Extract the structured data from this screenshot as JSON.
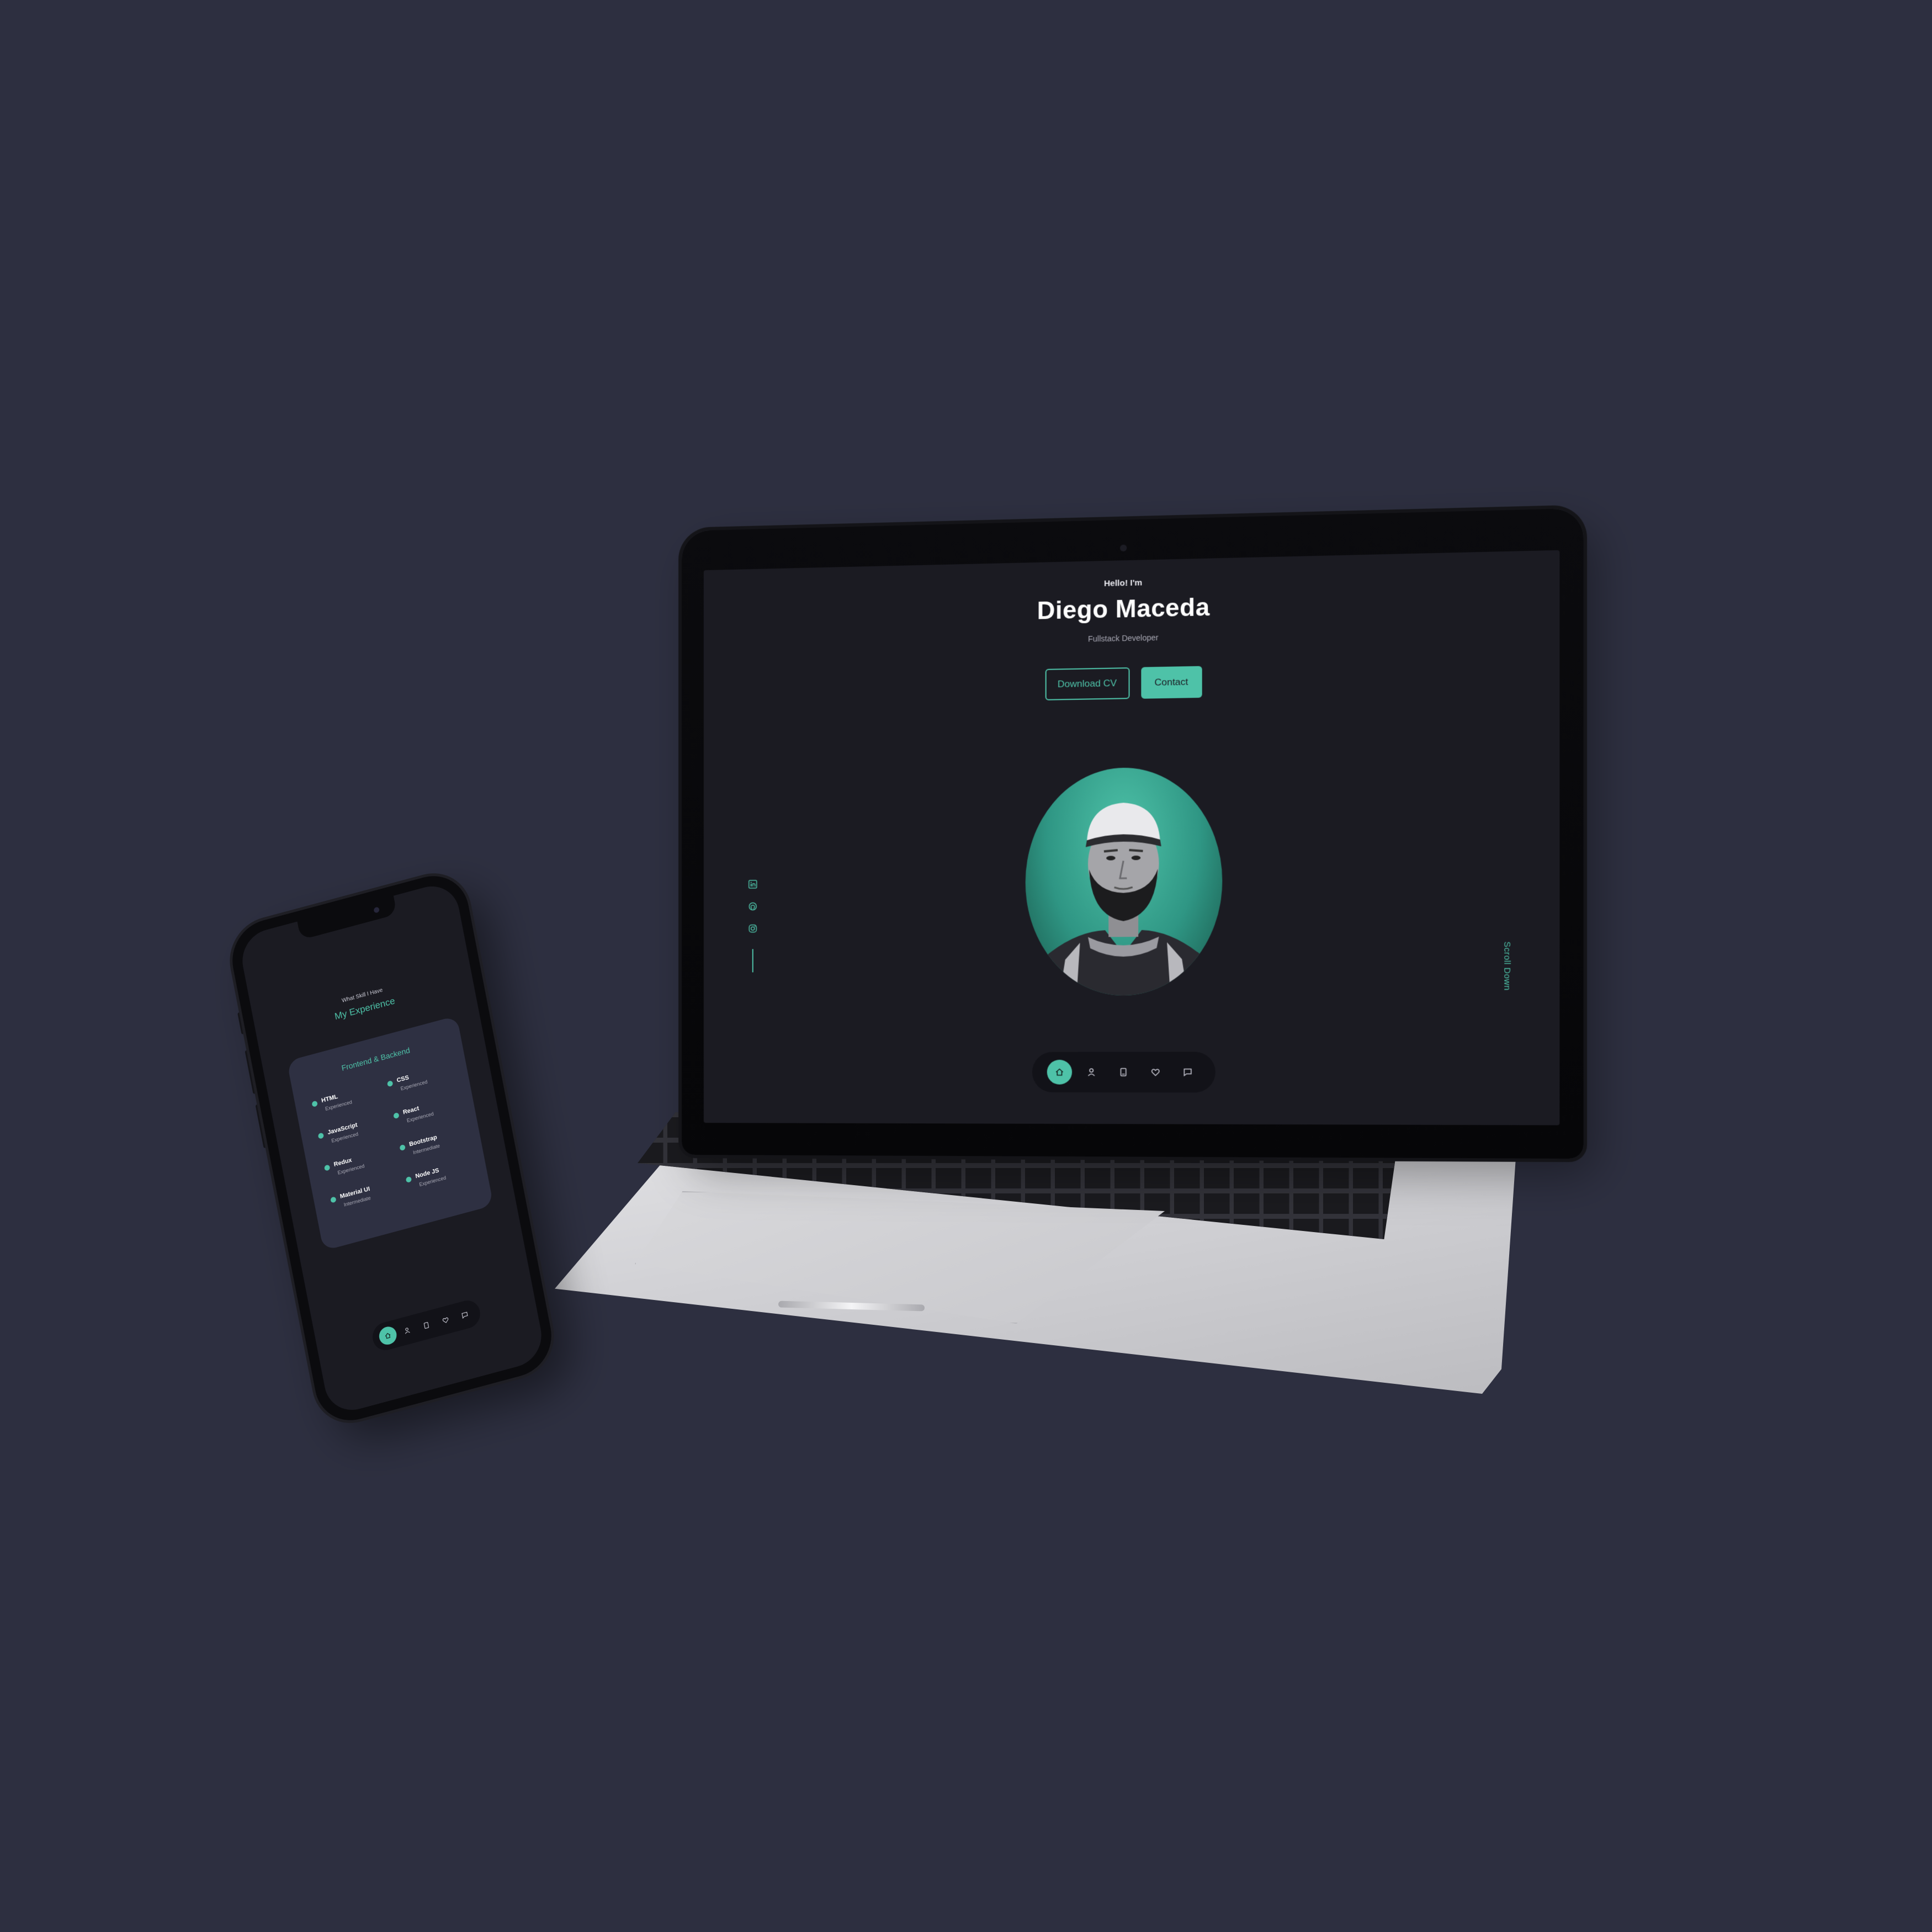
{
  "laptop": {
    "greeting": "Hello! I'm",
    "name": "Diego Maceda",
    "role": "Fullstack Developer",
    "buttons": {
      "download_cv": "Download CV",
      "contact": "Contact"
    },
    "socials": [
      "linkedin-icon",
      "github-icon",
      "instagram-icon"
    ],
    "scroll_down": "Scroll Down",
    "nav": [
      "home-icon",
      "user-icon",
      "book-icon",
      "heart-icon",
      "message-icon"
    ],
    "active_nav": "home-icon"
  },
  "phone": {
    "subtitle": "What Skill I Have",
    "title": "My Experience",
    "card_title": "Frontend & Backend",
    "skills": [
      {
        "name": "HTML",
        "level": "Experienced"
      },
      {
        "name": "CSS",
        "level": "Experienced"
      },
      {
        "name": "JavaScript",
        "level": "Experienced"
      },
      {
        "name": "React",
        "level": "Experienced"
      },
      {
        "name": "Redux",
        "level": "Experienced"
      },
      {
        "name": "Bootstrap",
        "level": "Intermediate"
      },
      {
        "name": "Material UI",
        "level": "Intermediate"
      },
      {
        "name": "Node JS",
        "level": "Experienced"
      }
    ],
    "nav": [
      "home-icon",
      "user-icon",
      "book-icon",
      "heart-icon",
      "message-icon"
    ]
  },
  "colors": {
    "background": "#2d2f40",
    "screen": "#1b1b22",
    "accent": "#4ec2a8",
    "card": "#2e3042"
  }
}
